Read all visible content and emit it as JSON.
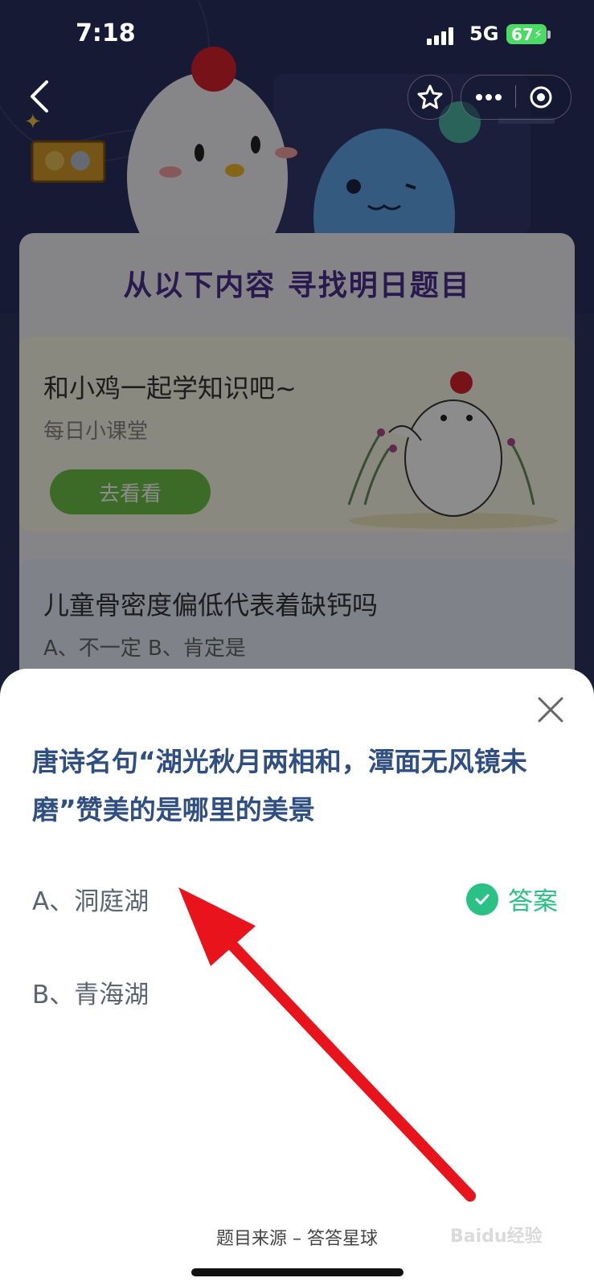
{
  "status_bar": {
    "time": "7:18",
    "network": "5G",
    "battery": "67"
  },
  "banner": {
    "title": "从以下内容  寻找明日题目"
  },
  "feature_card": {
    "title": "和小鸡一起学知识吧~",
    "subtitle": "每日小课堂",
    "button_label": "去看看"
  },
  "quiz_card": {
    "title": "儿童骨密度偏低代表着缺钙吗",
    "options": "A、不一定    B、肯定是"
  },
  "sheet": {
    "question": "唐诗名句“湖光秋月两相和，潭面无风镜未磨”赞美的是哪里的美景",
    "option_a": "A、洞庭湖",
    "option_b": "B、青海湖",
    "answer_label": "答案",
    "source": "题目来源 – 答答星球"
  },
  "watermark": "Baidu经验",
  "colors": {
    "banner_bg": "#2a3160",
    "answer_green": "#2cc184",
    "question_blue": "#2f4f82",
    "arrow_red": "#e8131b"
  },
  "icons": [
    "back-icon",
    "star-icon",
    "more-icon",
    "target-icon",
    "close-icon",
    "check-icon",
    "signal-icon",
    "battery-icon"
  ]
}
